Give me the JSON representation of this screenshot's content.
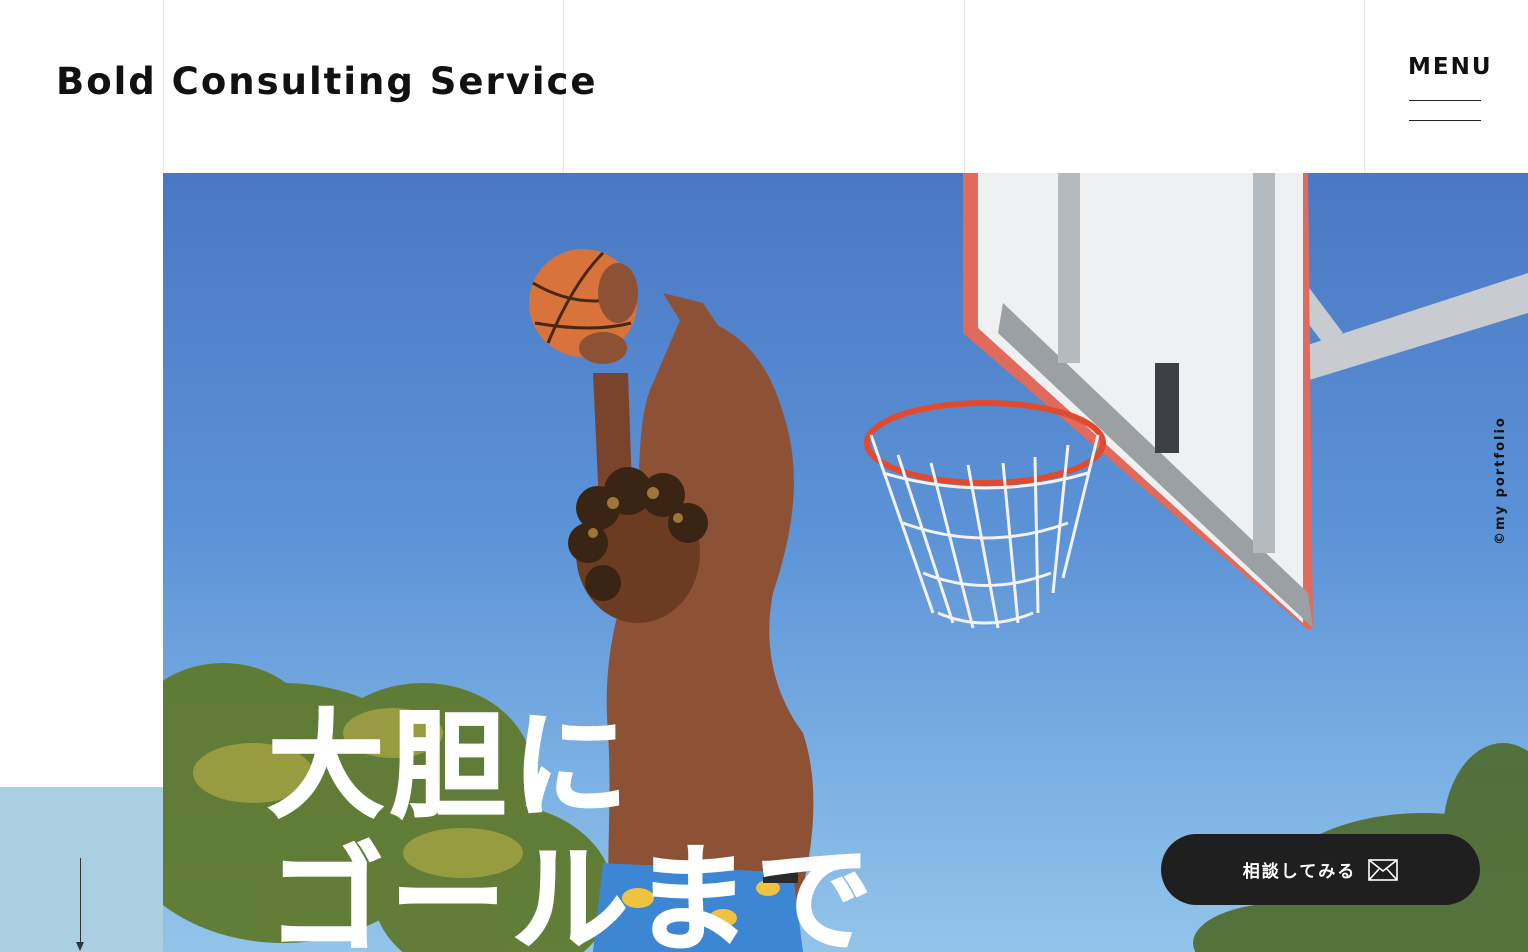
{
  "header": {
    "logo": "Bold Consulting Service",
    "menu_label": "MENU"
  },
  "hero": {
    "headline_line1": "大胆に",
    "headline_line2": "ゴールまで",
    "credit": "©my portfolio"
  },
  "cta": {
    "label": "相談してみる",
    "icon": "envelope-icon"
  },
  "scroll": {
    "icon": "arrow-down-icon"
  },
  "colors": {
    "side_panel": "#a9cfe0",
    "cta_background": "#1f1f1f",
    "sky": "#5b92d6"
  }
}
